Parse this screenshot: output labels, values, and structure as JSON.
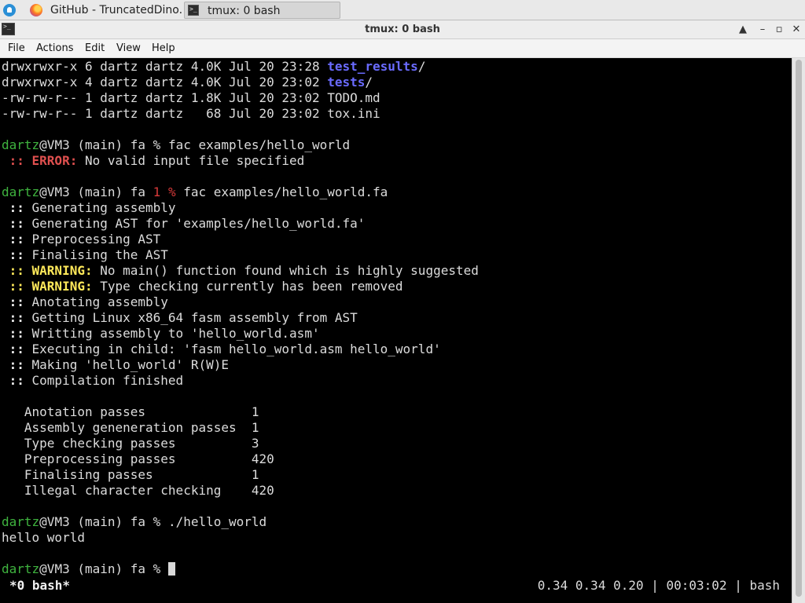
{
  "taskbar": {
    "tasks": [
      {
        "label": "GitHub - TruncatedDino...",
        "icon": "firefox-icon"
      },
      {
        "label": "tmux: 0 bash",
        "icon": "terminal-icon"
      }
    ]
  },
  "window": {
    "title": "tmux: 0 bash",
    "buttons": {
      "maximize": "▲",
      "minimize": "–",
      "restore": "▫",
      "close": "✕"
    }
  },
  "menu": {
    "items": [
      "File",
      "Actions",
      "Edit",
      "View",
      "Help"
    ]
  },
  "terminal": {
    "ls": [
      {
        "meta": "drwxrwxr-x 6 dartz dartz 4.0K Jul 20 23:28 ",
        "name": "test_results",
        "suffix": "/"
      },
      {
        "meta": "drwxrwxr-x 4 dartz dartz 4.0K Jul 20 23:02 ",
        "name": "tests",
        "suffix": "/"
      },
      {
        "meta": "-rw-rw-r-- 1 dartz dartz 1.8K Jul 20 23:02 ",
        "name": "TODO.md",
        "suffix": ""
      },
      {
        "meta": "-rw-rw-r-- 1 dartz dartz   68 Jul 20 23:02 ",
        "name": "tox.ini",
        "suffix": ""
      }
    ],
    "prompt_user": "dartz",
    "prompt_rest": "@VM3 (main) fa ",
    "prompt_symbol": "%",
    "cmd1": " fac examples/hello_world",
    "error_prefix": " :: ",
    "error_label": "ERROR:",
    "error_msg": " No valid input file specified",
    "exit_code": "1 %",
    "cmd2": " fac examples/hello_world.fa",
    "log_prefix": " :: ",
    "log": [
      "Generating assembly",
      "Generating AST for 'examples/hello_world.fa'",
      "Preprocessing AST",
      "Finalising the AST"
    ],
    "warn_prefix": " :: ",
    "warn_label": "WARNING:",
    "warnings": [
      " No main() function found which is highly suggested",
      " Type checking currently has been removed"
    ],
    "log2": [
      "Anotating assembly",
      "Getting Linux x86_64 fasm assembly from AST",
      "Writting assembly to 'hello_world.asm'",
      "Executing in child: 'fasm hello_world.asm hello_world'",
      "Making 'hello_world' R(W)E",
      "Compilation finished"
    ],
    "stats": [
      "   Anotation passes              1",
      "   Assembly geneneration passes  1",
      "   Type checking passes          3",
      "   Preprocessing passes          420",
      "   Finalising passes             1",
      "   Illegal character checking    420"
    ],
    "cmd3": " ./hello_world",
    "output": "hello world",
    "cmd4": " "
  },
  "tmux_status": {
    "left": "*0 bash*",
    "right": "0.34 0.34 0.20 | 00:03:02 | bash"
  }
}
